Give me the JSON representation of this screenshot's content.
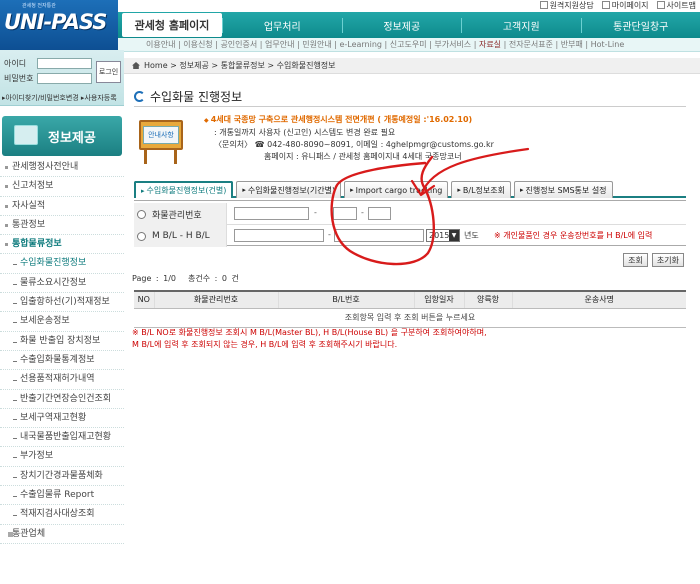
{
  "logo": {
    "sub": "관세청 전자통관",
    "name": "UNI-PASS"
  },
  "util_links": [
    "원격지원상담",
    "마이페이지",
    "사이트맵"
  ],
  "main_nav": {
    "home": "관세청 홈페이지",
    "items": [
      "업무처리",
      "정보제공",
      "고객지원",
      "통관단일창구"
    ]
  },
  "sub_nav": {
    "left": "이용안내 | 이용신청 | 공인인증서 | 업무안내 | 민원안내 | e-Learning | 신고도우미 | 부가서비스 | ",
    "highlight": "자료실",
    "right": " | 전자문서표준 | 반부패 | Hot-Line"
  },
  "login": {
    "id_label": "아이디",
    "pw_label": "비밀번호",
    "button": "로그인",
    "links": "▸아이디찾기/비밀번호변경 ▸사용자등록"
  },
  "sidebar": {
    "title": "정보제공",
    "items": [
      {
        "label": "관세행정사전안내",
        "type": "main"
      },
      {
        "label": "신고처정보",
        "type": "main"
      },
      {
        "label": "자사실적",
        "type": "main"
      },
      {
        "label": "통관정보",
        "type": "main"
      },
      {
        "label": "통합물류정보",
        "type": "main-active"
      },
      {
        "label": "수입화물진행정보",
        "type": "sub-sel"
      },
      {
        "label": "물류소요시간정보",
        "type": "sub"
      },
      {
        "label": "입출항하선(기)적재정보",
        "type": "sub"
      },
      {
        "label": "보세운송정보",
        "type": "sub"
      },
      {
        "label": "화물 반출입 장치정보",
        "type": "sub"
      },
      {
        "label": "수출입화물통계정보",
        "type": "sub"
      },
      {
        "label": "선용품적재허가내역",
        "type": "sub"
      },
      {
        "label": "반출기간연장승인건조회",
        "type": "sub"
      },
      {
        "label": "보세구역재고현황",
        "type": "sub"
      },
      {
        "label": "내국물품반출입재고현황",
        "type": "sub"
      },
      {
        "label": "부가정보",
        "type": "sub"
      },
      {
        "label": "장치기간경과물품체화",
        "type": "sub"
      },
      {
        "label": "수출입물류 Report",
        "type": "sub"
      },
      {
        "label": "적재지검사대상조회",
        "type": "sub"
      },
      {
        "label": "통관업체",
        "type": "last"
      }
    ]
  },
  "breadcrumb": [
    "Home",
    "정보제공",
    "통합물류정보",
    "수입화물진행정보"
  ],
  "page_title": "수입화물 진행정보",
  "notice_board_label": "안내사항",
  "notice": {
    "headline": "4세대 국종망 구축으로 관세행정시스템 전면개편 ( 개통예정일 :'16.02.10)",
    "line1": ": 개통일까지 사용자 (신고인) 시스템도 변경 완료 필요",
    "line2": "〈문의처〉 ☎ 042-480-8090~8091, 이메일 : 4ghelpmgr@customs.go.kr",
    "line3": "홈페이지 : 유니패스 / 관세청 홈페이지내 4세대 국종망코너"
  },
  "tabs": [
    "수입화물진행정보(건별)",
    "수입화물진행정보(기간별)",
    "Import cargo tracking",
    "B/L정보조회",
    "진행정보 SMS통보 설정"
  ],
  "form": {
    "row1_label": "화물관리번호",
    "row2_label": "M B/L - H B/L",
    "year": "2015",
    "year_unit": "년도",
    "hint": "※ 개인물품인 경우 운송장번호를 H B/L에 입력"
  },
  "buttons": {
    "search": "조회",
    "reset": "초기화"
  },
  "count": {
    "page": "Page : 1/0",
    "total": "총건수 : 0 건"
  },
  "table": {
    "headers": [
      "NO",
      "화물관리번호",
      "B/L번호",
      "입항일자",
      "양륙항",
      "운송사명"
    ],
    "empty": "조회항목 입력 후 조회 버튼을 누르세요"
  },
  "warning": [
    "※ B/L NO로 화물진행정보 조회시 M B/L(Master BL), H B/L(House BL) 을 구분하여 조회하여야하며,",
    "M B/L에 입력 후 조회되지 않는 경우, H B/L에 입력 후 조회해주시기 바랍니다."
  ],
  "colors": {
    "teal": "#1b7f82",
    "brand_blue": "#1d6fb8",
    "alert_red": "#cc0000",
    "notice_orange": "#e06a00",
    "annotation_red": "#d81b1b"
  }
}
